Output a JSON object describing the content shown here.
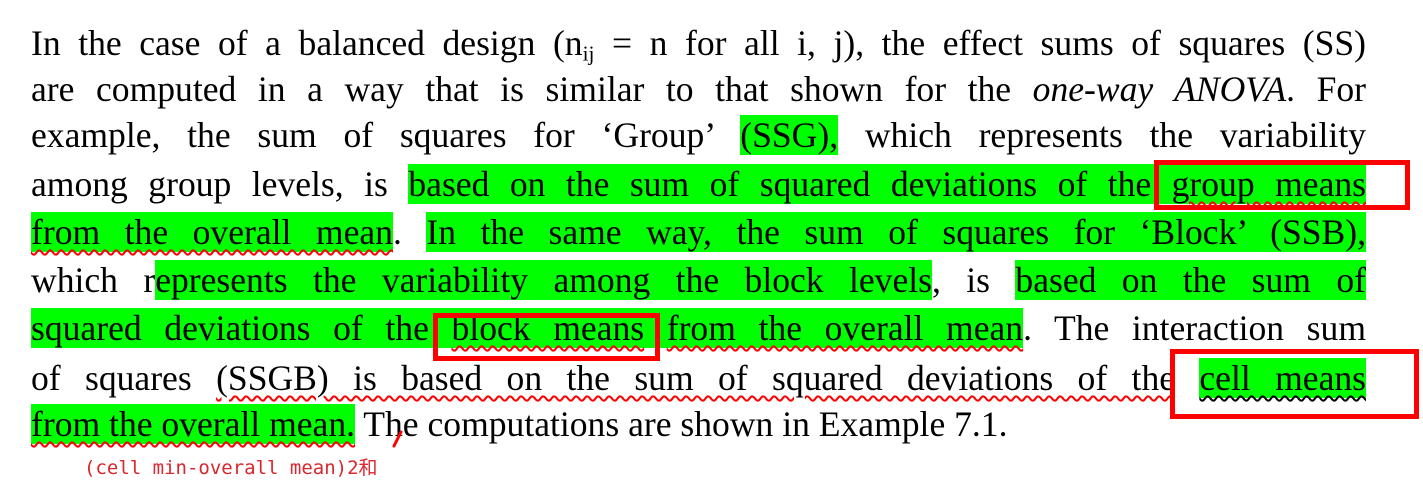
{
  "paragraph": {
    "l1": {
      "a": "In the case of a balanced design (n",
      "sub": "ij",
      "b": " = n for all i, j), the effect sums of squares (SS)"
    },
    "l2": {
      "a": "are computed in a way that is similar to that shown for the ",
      "italic": "one-way ANOVA",
      "b": ". For"
    },
    "l3": {
      "a": "example, the sum of squares for ‘Group’ ",
      "hl": "(SSG),",
      "b": " which represents the variability"
    },
    "l4": {
      "a": "among group levels, is ",
      "hl": "based on the sum of squared deviations of the ",
      "hl_wavy": "group means"
    },
    "l5": {
      "hl_wavy": "from the overall mean",
      "a": ". ",
      "hl": "In the same way, the sum of squares for ‘Block’ (SSB),"
    },
    "l6": {
      "a": "which r",
      "hl1": "epresents the variability among the block levels",
      "b": ", is ",
      "hl2": "based on the sum of"
    },
    "l7": {
      "hl1": "squared deviations of the ",
      "hl_wavy1": "block means",
      "sp": " ",
      "hl_wavy2": "from the overall mean",
      "a": ". The interaction sum"
    },
    "l8": {
      "a": "of squares ",
      "wavy": "(SSGB) is based on the sum of squared deviations of the",
      "sp": " ",
      "hl_wavy_dark": "cell means"
    },
    "l9": {
      "hl_wavy": "from the overall mean.",
      "a": " The computations are shown in Example 7.1."
    }
  },
  "annotation": {
    "note": "(cell min-overall mean)2和"
  },
  "colors": {
    "highlight": "#00ff00",
    "box": "#ff0000",
    "note": "#d9272e"
  }
}
